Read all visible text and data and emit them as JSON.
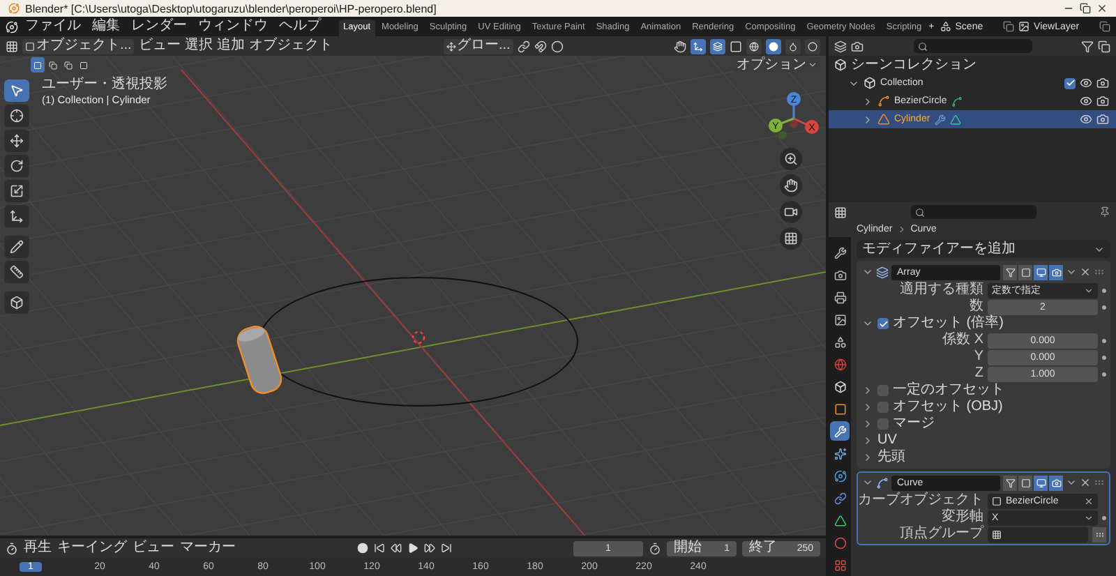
{
  "window": {
    "title": "Blender* [C:\\Users\\utoga\\Desktop\\utogaruzu\\blender\\peroperoi\\HP-peropero.blend]"
  },
  "menu": [
    "ファイル",
    "編集",
    "レンダー",
    "ウィンドウ",
    "ヘルプ"
  ],
  "workspaces": [
    {
      "label": "Layout",
      "selected": true
    },
    {
      "label": "Modeling",
      "selected": false
    },
    {
      "label": "Sculpting",
      "selected": false
    },
    {
      "label": "UV Editing",
      "selected": false
    },
    {
      "label": "Texture Paint",
      "selected": false
    },
    {
      "label": "Shading",
      "selected": false
    },
    {
      "label": "Animation",
      "selected": false
    },
    {
      "label": "Rendering",
      "selected": false
    },
    {
      "label": "Compositing",
      "selected": false
    },
    {
      "label": "Geometry Nodes",
      "selected": false
    },
    {
      "label": "Scripting",
      "selected": false
    }
  ],
  "add_workspace": "+",
  "scene": "Scene",
  "view_layer": "ViewLayer",
  "viewport": {
    "mode": "オブジェクト...",
    "menus": [
      "ビュー",
      "選択",
      "追加",
      "オブジェクト"
    ],
    "orientation": "グロー...",
    "options": "オプション",
    "view_name": "ユーザー・透視投影",
    "context": "(1) Collection | Cylinder",
    "gizmo": [
      "X",
      "Y",
      "Z"
    ],
    "tools": [
      {
        "kind": "select",
        "selected": true
      },
      {
        "kind": "cursor",
        "selected": false
      },
      {
        "kind": "move",
        "selected": false
      },
      {
        "kind": "rotate",
        "selected": false
      },
      {
        "kind": "scale",
        "selected": false
      },
      {
        "kind": "transform",
        "selected": false
      },
      {
        "kind": "annotate",
        "selected": false
      },
      {
        "kind": "measure",
        "selected": false
      },
      {
        "kind": "add_cube",
        "selected": false
      }
    ]
  },
  "outliner": {
    "title": "シーンコレクション",
    "items": [
      {
        "label": "Collection",
        "kind": "collection",
        "checked": true,
        "expanded": true,
        "selected": false,
        "children": [
          {
            "label": "BezierCircle",
            "kind": "curve",
            "expanded": false,
            "selected": false
          },
          {
            "label": "Cylinder",
            "kind": "mesh",
            "expanded": false,
            "selected": true
          }
        ]
      }
    ]
  },
  "properties": {
    "breadcrumb": [
      "Cylinder",
      "Curve"
    ],
    "add_modifier": "モディファイアーを追加",
    "tabs": [
      {
        "kind": "tool",
        "selected": false
      },
      {
        "kind": "render",
        "selected": false
      },
      {
        "kind": "output",
        "selected": false
      },
      {
        "kind": "view_layer",
        "selected": false
      },
      {
        "kind": "scene",
        "selected": false
      },
      {
        "kind": "world",
        "selected": false
      },
      {
        "kind": "collection",
        "selected": false
      },
      {
        "kind": "object",
        "selected": false
      },
      {
        "kind": "modifier",
        "selected": true
      },
      {
        "kind": "particles",
        "selected": false
      },
      {
        "kind": "physics",
        "selected": false
      },
      {
        "kind": "constraints",
        "selected": false
      },
      {
        "kind": "data",
        "selected": false
      },
      {
        "kind": "material",
        "selected": false
      },
      {
        "kind": "texture",
        "selected": false
      }
    ],
    "modifiers": [
      {
        "kind": "array",
        "name": "Array",
        "expanded": true,
        "fields": [
          {
            "label": "適用する種類",
            "value": "定数で指定",
            "kind": "dropdown"
          },
          {
            "label": "数",
            "value": "2",
            "kind": "number"
          }
        ],
        "subpanels": [
          {
            "label": "オフセット (倍率)",
            "checked": true,
            "expanded": true,
            "fields": [
              {
                "label": "係数 X",
                "value": "0.000",
                "kind": "number"
              },
              {
                "label": "Y",
                "value": "0.000",
                "kind": "number"
              },
              {
                "label": "Z",
                "value": "1.000",
                "kind": "number"
              }
            ]
          },
          {
            "label": "一定のオフセット",
            "checked": false,
            "expanded": false
          },
          {
            "label": "オフセット (OBJ)",
            "checked": false,
            "expanded": false
          },
          {
            "label": "マージ",
            "checked": false,
            "expanded": false
          },
          {
            "label": "UV",
            "expanded": false
          },
          {
            "label": "先頭",
            "expanded": false
          }
        ]
      },
      {
        "kind": "curve",
        "name": "Curve",
        "expanded": true,
        "fields": [
          {
            "label": "カーブオブジェクト",
            "value": "BezierCircle",
            "kind": "object"
          },
          {
            "label": "変形軸",
            "value": "X",
            "kind": "dropdown"
          },
          {
            "label": "頂点グループ",
            "kind": "vertex_group"
          }
        ]
      }
    ]
  },
  "timeline": {
    "menus": [
      "再生",
      "キーイング",
      "ビュー",
      "マーカー"
    ],
    "current_frame": "1",
    "start_label": "開始",
    "start": "1",
    "end_label": "終了",
    "end": "250",
    "ruler": {
      "current": "1",
      "ticks": [
        "20",
        "40",
        "60",
        "80",
        "100",
        "120",
        "140",
        "160",
        "180",
        "200",
        "220",
        "240"
      ]
    }
  }
}
